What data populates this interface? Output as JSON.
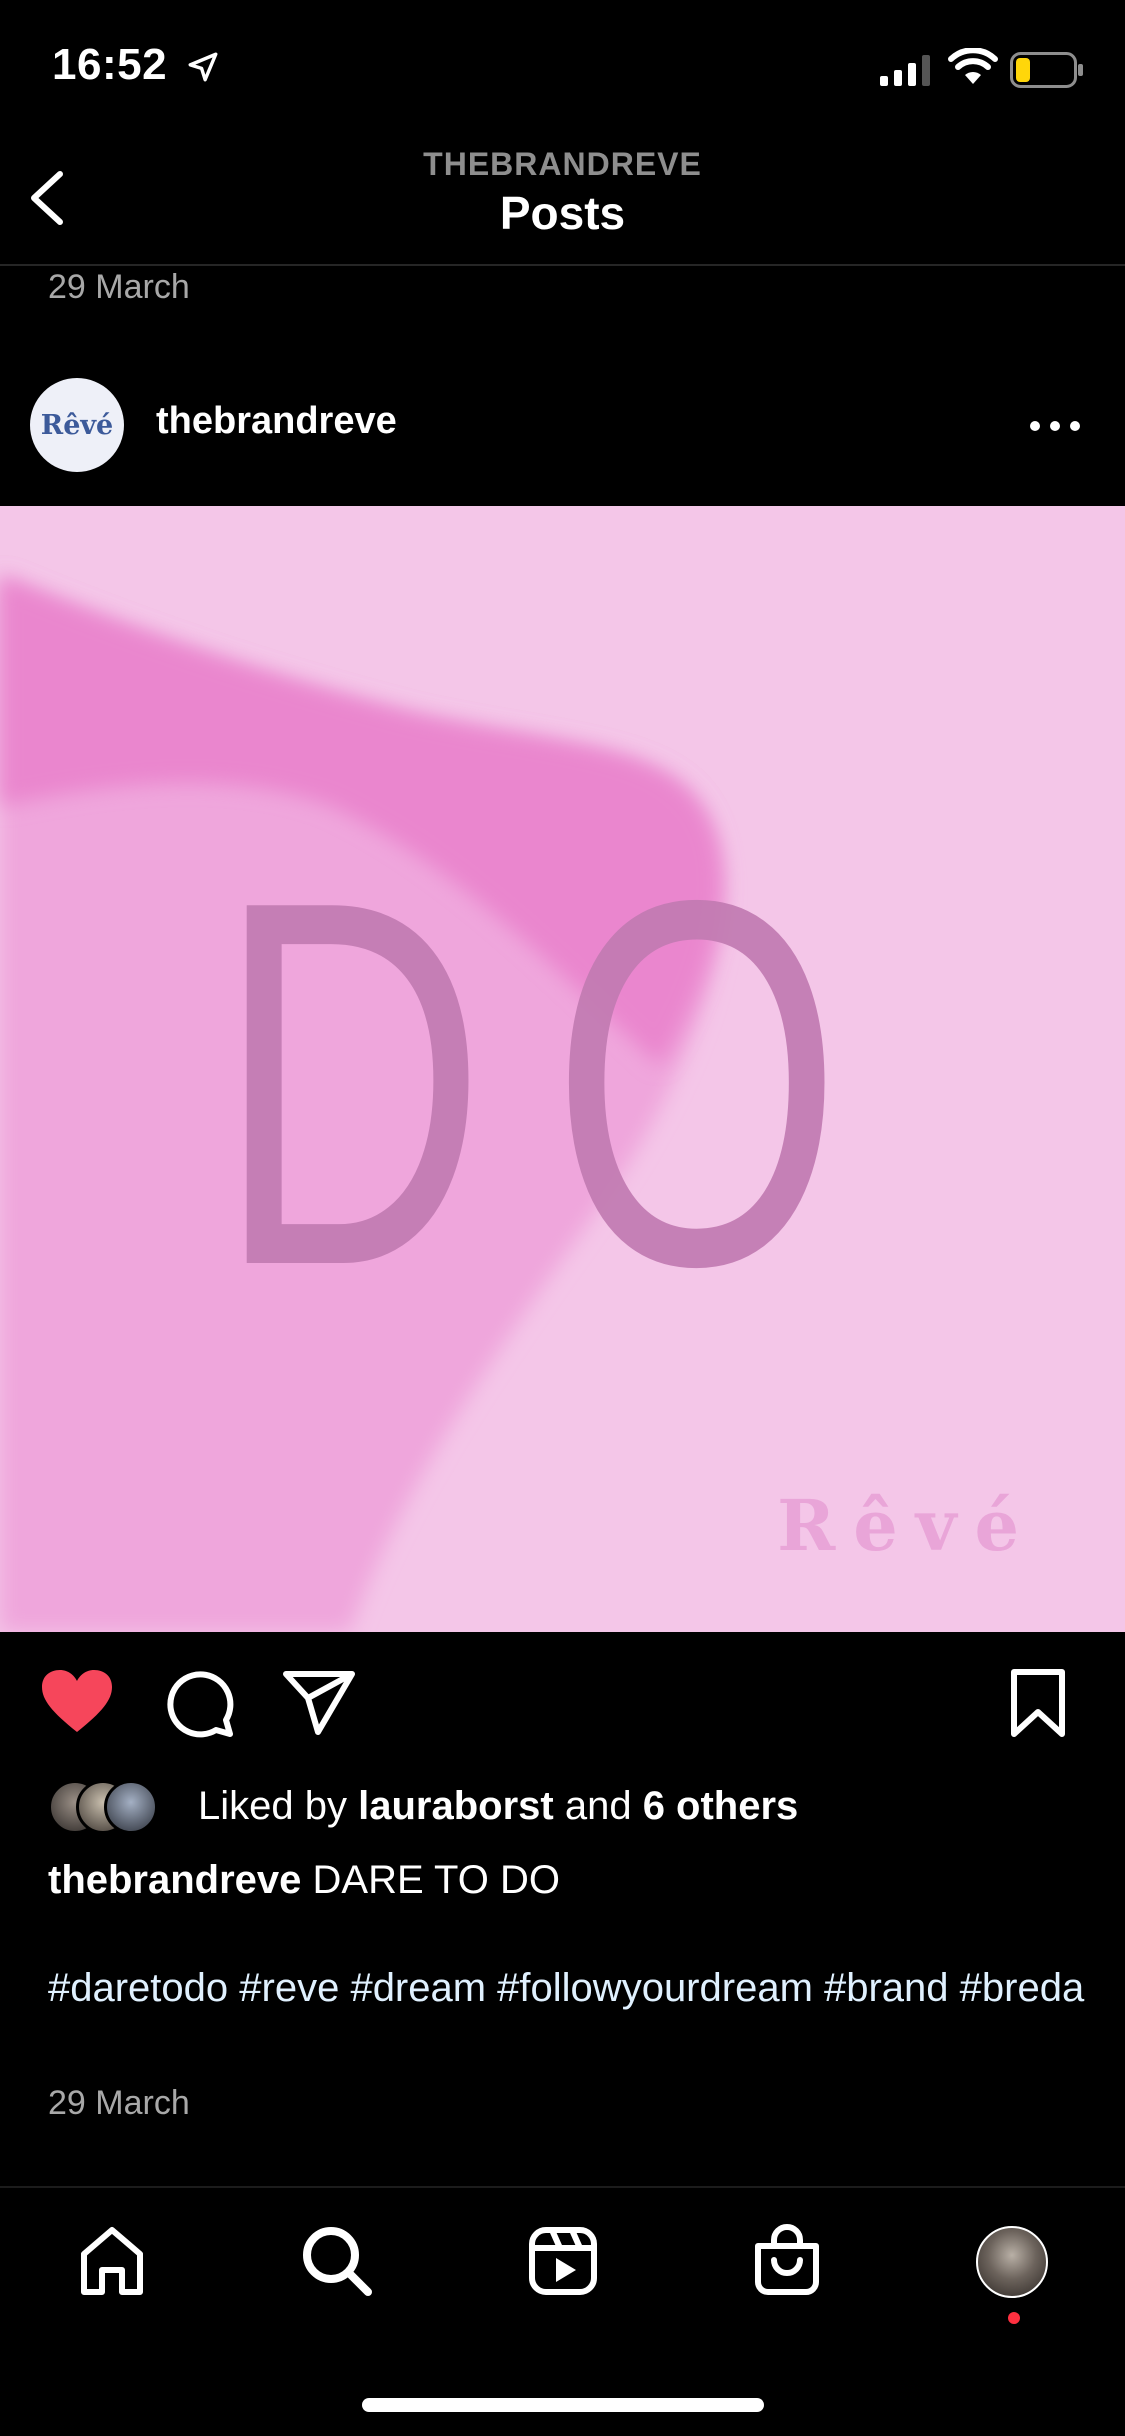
{
  "status_bar": {
    "time": "16:52"
  },
  "header": {
    "account": "THEBRANDREVE",
    "title": "Posts"
  },
  "previous_post": {
    "date": "29 March"
  },
  "post": {
    "username": "thebrandreve",
    "avatar_text": "Rêvé",
    "image": {
      "text": "DO",
      "brand_mark": "Rêvé"
    },
    "likes": {
      "prefix": "Liked by ",
      "user": "lauraborst",
      "middle": " and ",
      "others": "6 others",
      "liked": true
    },
    "caption": {
      "username": "thebrandreve",
      "text": " DARE TO DO"
    },
    "hashtags": "#daretodo #reve #dream #followyourdream #brand #breda",
    "date": "29 March"
  },
  "colors": {
    "heart": "#f6465b",
    "image_bg": "#f4c6e8",
    "swirl": "#ec8ccf",
    "notification_dot": "#ff3040"
  },
  "icons": [
    "back-chevron-icon",
    "more-options-icon",
    "heart-icon",
    "comment-icon",
    "share-icon",
    "bookmark-icon",
    "home-icon",
    "search-icon",
    "reels-icon",
    "shop-icon",
    "profile-icon"
  ]
}
